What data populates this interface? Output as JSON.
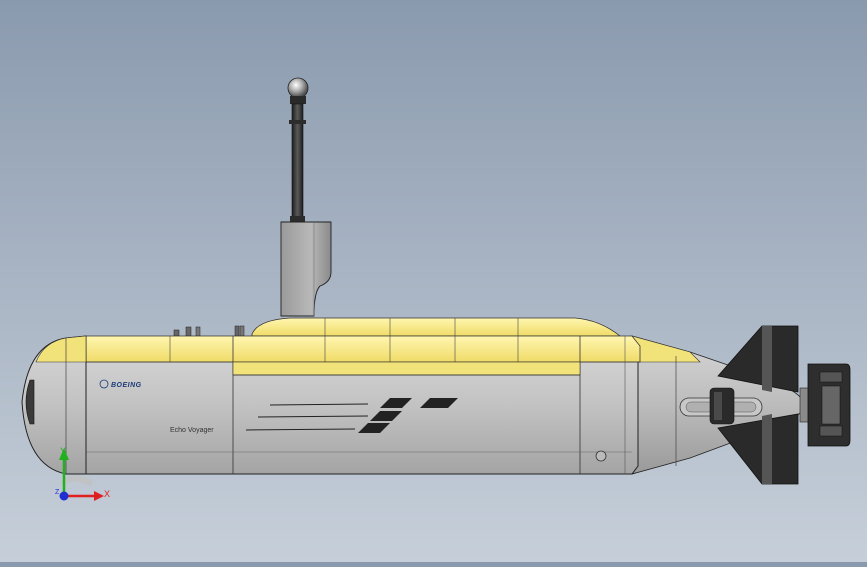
{
  "model": {
    "brand_text": "BOEING",
    "name_text": "Echo Voyager"
  },
  "triad": {
    "x_label": "X",
    "y_label": "Y",
    "z_label": "Z",
    "x_color": "#e02020",
    "y_color": "#20b020",
    "z_color": "#2030d0"
  },
  "colors": {
    "hull_yellow": "#f2e27a",
    "hull_gray": "#c4c4c4",
    "mast_dark": "#3a3a3a",
    "fin_dark": "#2a2a2a"
  }
}
